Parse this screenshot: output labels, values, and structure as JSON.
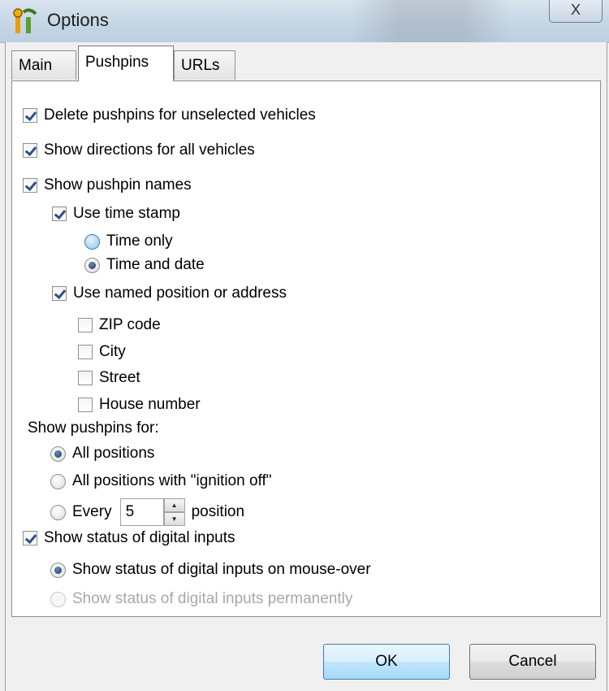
{
  "window": {
    "title": "Options",
    "close_glyph": "X",
    "app_icon": "pushpin-app-icon"
  },
  "tabs": [
    {
      "label": "Main"
    },
    {
      "label": "Pushpins",
      "active": true
    },
    {
      "label": "URLs"
    }
  ],
  "options": {
    "delete_pushpins": {
      "label": "Delete pushpins for unselected vehicles",
      "checked": true
    },
    "show_directions": {
      "label": "Show directions for all vehicles",
      "checked": true
    },
    "show_names": {
      "label": "Show pushpin names",
      "checked": true
    },
    "use_timestamp": {
      "label": "Use time stamp",
      "checked": true
    },
    "time_only": {
      "label": "Time only",
      "selected": false
    },
    "time_and_date": {
      "label": "Time and date",
      "selected": true
    },
    "use_named_position": {
      "label": "Use named position or address",
      "checked": true
    },
    "zip_code": {
      "label": "ZIP code",
      "checked": false
    },
    "city": {
      "label": "City",
      "checked": false
    },
    "street": {
      "label": "Street",
      "checked": false
    },
    "house_number": {
      "label": "House number",
      "checked": false
    },
    "show_pushpins_for_label": "Show pushpins for:",
    "all_positions": {
      "label": "All positions",
      "selected": true
    },
    "ignition_off": {
      "label": "All positions with \"ignition off\"",
      "selected": false
    },
    "every": {
      "label_before": "Every",
      "value": "5",
      "label_after": "position",
      "selected": false
    },
    "show_digital_inputs": {
      "label": "Show status of digital inputs",
      "checked": true
    },
    "digital_mouseover": {
      "label": "Show status of digital inputs on mouse-over",
      "selected": true
    },
    "digital_permanent": {
      "label": "Show status of digital inputs permanently",
      "selected": false,
      "disabled": true
    }
  },
  "buttons": {
    "ok": "OK",
    "cancel": "Cancel"
  }
}
